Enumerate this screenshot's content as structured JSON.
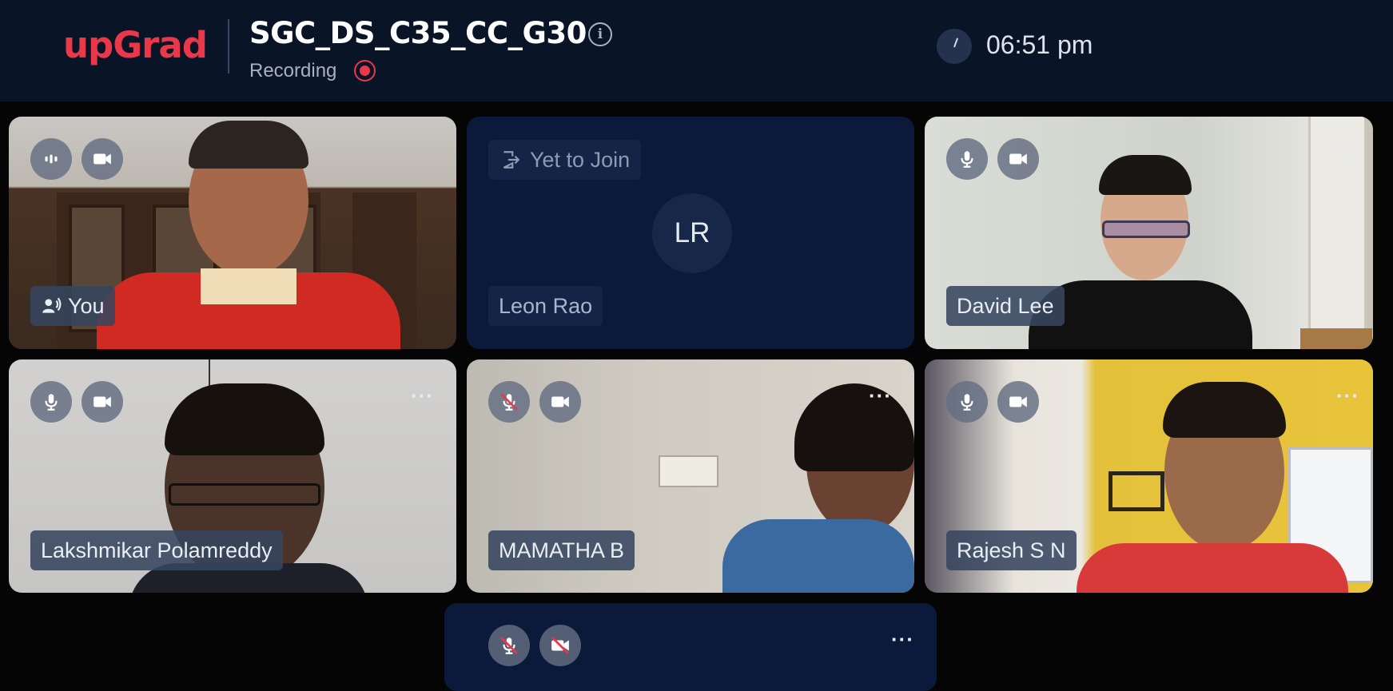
{
  "header": {
    "logo": "upGrad",
    "meeting_title": "SGC_DS_C35_CC_G30",
    "info_icon": "i",
    "recording_label": "Recording",
    "time": "06:51 pm"
  },
  "participants": [
    {
      "name": "You",
      "mic": "active-speaking-icon",
      "camera": "video-camera-icon"
    },
    {
      "name": "Leon Rao",
      "initials": "LR",
      "status": "Yet to Join"
    },
    {
      "name": "David Lee",
      "mic": "microphone-icon",
      "camera": "video-camera-icon"
    },
    {
      "name": "Lakshmikar Polamreddy",
      "mic": "microphone-icon",
      "camera": "video-camera-icon"
    },
    {
      "name": "MAMATHA B",
      "mic": "microphone-muted-icon",
      "camera": "video-camera-icon"
    },
    {
      "name": "Rajesh S N",
      "mic": "microphone-icon",
      "camera": "video-camera-icon"
    },
    {
      "name": "",
      "mic": "microphone-muted-icon",
      "camera": "video-camera-off-icon"
    }
  ],
  "more_glyph": "···",
  "colors": {
    "brand": "#e8384a",
    "header_bg": "#0a1427",
    "tile_bg": "#0b1a3a"
  }
}
